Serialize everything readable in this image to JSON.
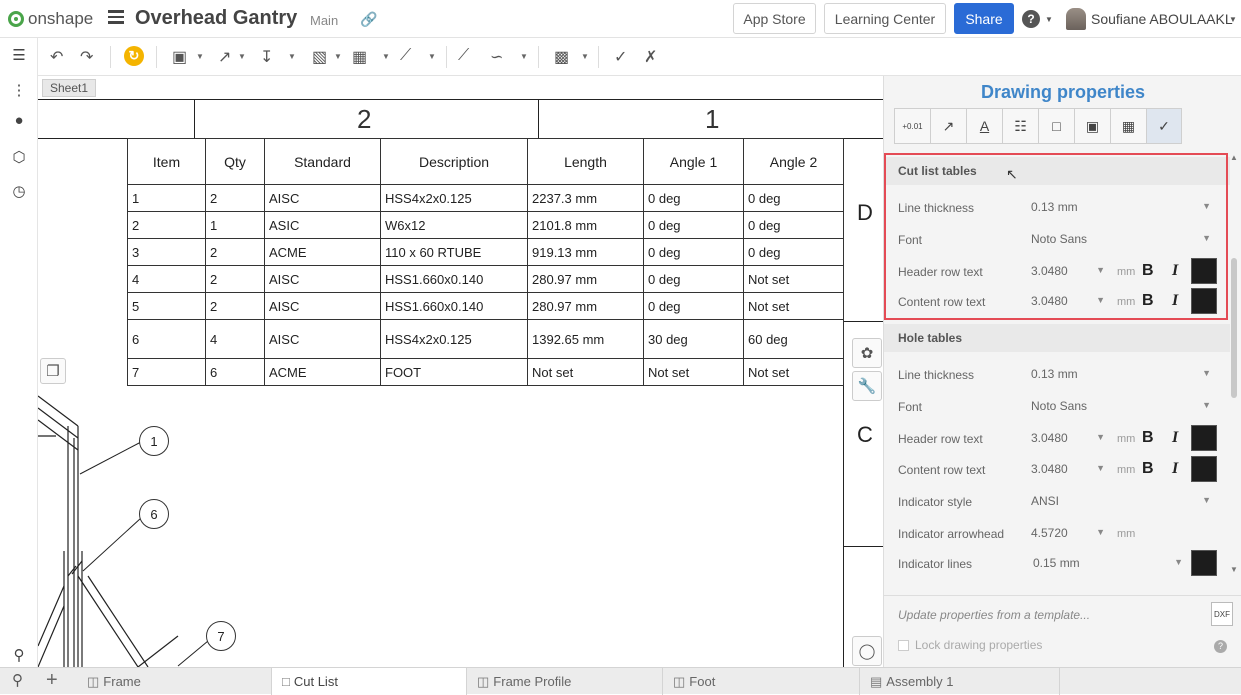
{
  "topbar": {
    "logo_text": "onshape",
    "doc_title": "Overhead Gantry",
    "branch": "Main",
    "app_store": "App Store",
    "learning_center": "Learning Center",
    "share": "Share",
    "help": "?",
    "user_name": "Soufiane ABOULAAKL"
  },
  "canvas": {
    "sheet_tab": "Sheet1",
    "zone_top_2": "2",
    "zone_top_1": "1",
    "zone_side_d": "D",
    "zone_side_c": "C",
    "table_headers": [
      "Item",
      "Qty",
      "Standard",
      "Description",
      "Length",
      "Angle 1",
      "Angle 2"
    ],
    "rows": [
      [
        "1",
        "2",
        "AISC",
        "HSS4x2x0.125",
        "2237.3 mm",
        "0 deg",
        "0 deg"
      ],
      [
        "2",
        "1",
        "ASIC",
        "W6x12",
        "2101.8 mm",
        "0 deg",
        "0 deg"
      ],
      [
        "3",
        "2",
        "ACME",
        "110 x 60 RTUBE",
        "919.13 mm",
        "0 deg",
        "0 deg"
      ],
      [
        "4",
        "2",
        "AISC",
        "HSS1.660x0.140",
        "280.97 mm",
        "0 deg",
        "Not set"
      ],
      [
        "5",
        "2",
        "AISC",
        "HSS1.660x0.140",
        "280.97 mm",
        "0 deg",
        "Not set"
      ],
      [
        "6",
        "4",
        "AISC",
        "HSS4x2x0.125",
        "1392.65 mm",
        "30 deg",
        "60 deg"
      ],
      [
        "7",
        "6",
        "ACME",
        "FOOT",
        "Not set",
        "Not set",
        "Not set"
      ]
    ],
    "balloons": [
      "1",
      "6",
      "7"
    ]
  },
  "panel": {
    "title": "Drawing properties",
    "cut_list": {
      "heading": "Cut list tables",
      "line_thickness_label": "Line thickness",
      "line_thickness_value": "0.13 mm",
      "font_label": "Font",
      "font_value": "Noto Sans",
      "header_row_label": "Header row text",
      "header_row_value": "3.0480",
      "content_row_label": "Content row text",
      "content_row_value": "3.0480",
      "unit": "mm",
      "bold": "B",
      "italic": "I"
    },
    "hole": {
      "heading": "Hole tables",
      "line_thickness_label": "Line thickness",
      "line_thickness_value": "0.13 mm",
      "font_label": "Font",
      "font_value": "Noto Sans",
      "header_row_label": "Header row text",
      "header_row_value": "3.0480",
      "content_row_label": "Content row text",
      "content_row_value": "3.0480",
      "indicator_style_label": "Indicator style",
      "indicator_style_value": "ANSI",
      "indicator_arrowhead_label": "Indicator arrowhead",
      "indicator_arrowhead_value": "4.5720",
      "indicator_lines_label": "Indicator lines",
      "indicator_lines_value": "0.15 mm",
      "unit": "mm",
      "bold": "B",
      "italic": "I"
    },
    "template_link": "Update properties from a template...",
    "dxf_label": "DXF",
    "lock_label": "Lock drawing properties",
    "tab_num_label": "+0.01"
  },
  "bottom_tabs": [
    {
      "label": "Frame",
      "active": false
    },
    {
      "label": "Cut List",
      "active": true
    },
    {
      "label": "Frame Profile",
      "active": false
    },
    {
      "label": "Foot",
      "active": false
    },
    {
      "label": "Assembly 1",
      "active": false
    }
  ],
  "colors": {
    "accent_blue": "#2a6bd6",
    "panel_title": "#3f86c9",
    "highlight_box": "#e44b55",
    "refresh_yellow": "#f4b400"
  }
}
